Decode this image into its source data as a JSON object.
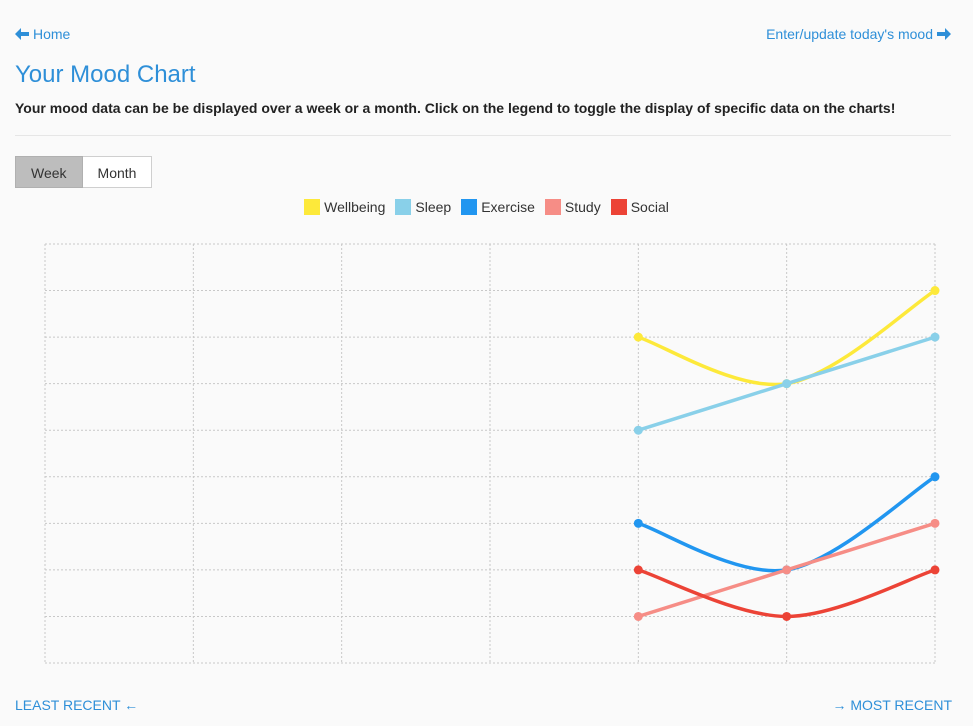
{
  "nav": {
    "home_label": "Home",
    "enter_label": "Enter/update today's mood"
  },
  "header": {
    "title": "Your Mood Chart",
    "subtitle": "Your mood data can be be displayed over a week or a month. Click on the legend to toggle the display of specific data on the charts!"
  },
  "period_toggle": {
    "options": [
      "Week",
      "Month"
    ],
    "selected": "Week"
  },
  "footer": {
    "left_label": "LEAST RECENT ←",
    "right_label": "→ MOST RECENT"
  },
  "chart_data": {
    "type": "line",
    "x": [
      1,
      2,
      3,
      4,
      5,
      6,
      7
    ],
    "ylim": [
      0,
      9
    ],
    "grid": true,
    "legend_position": "top-center",
    "series": [
      {
        "name": "Wellbeing",
        "color": "#fde93a",
        "values": [
          null,
          null,
          null,
          null,
          7,
          6,
          8
        ]
      },
      {
        "name": "Sleep",
        "color": "#89d0e9",
        "values": [
          null,
          null,
          null,
          null,
          5,
          6,
          7
        ]
      },
      {
        "name": "Exercise",
        "color": "#2196f0",
        "values": [
          null,
          null,
          null,
          null,
          3,
          2,
          4
        ]
      },
      {
        "name": "Study",
        "color": "#f68d86",
        "values": [
          null,
          null,
          null,
          null,
          1,
          2,
          3
        ]
      },
      {
        "name": "Social",
        "color": "#ec4336",
        "values": [
          null,
          null,
          null,
          null,
          2,
          1,
          2
        ]
      }
    ]
  }
}
